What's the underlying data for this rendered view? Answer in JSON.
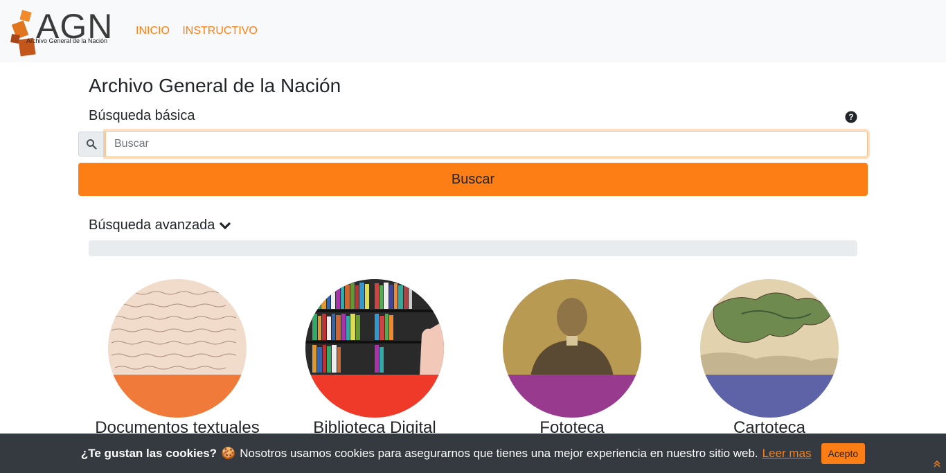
{
  "header": {
    "logo_text": "AGN",
    "logo_subtext": "Archivo General de la Nación",
    "nav": [
      "INICIO",
      "INSTRUCTIVO"
    ]
  },
  "main": {
    "title": "Archivo General de la Nación",
    "basic_search_label": "Búsqueda básica",
    "search_placeholder": "Buscar",
    "search_button": "Buscar",
    "advanced_search_label": "Búsqueda avanzada"
  },
  "categories": [
    {
      "label": "Documentos textuales",
      "band_color": "#f07a3a"
    },
    {
      "label": "Biblioteca Digital",
      "band_color": "#ef3a2a"
    },
    {
      "label": "Fototeca",
      "band_color": "#983a8e"
    },
    {
      "label": "Cartoteca",
      "band_color": "#5e63a8"
    }
  ],
  "cookie_bar": {
    "question": "¿Te gustan las cookies?",
    "emoji": "🍪",
    "message": "Nosotros usamos cookies para asegurarnos que tienes una mejor experiencia en nuestro sitio web.",
    "link": "Leer mas",
    "accept": "Acepto"
  },
  "colors": {
    "accent": "#fd7e14",
    "cookie_bg": "#343a40"
  },
  "icons": [
    "search-icon",
    "question-circle-icon",
    "chevron-down-icon",
    "chevron-up-double-icon"
  ]
}
